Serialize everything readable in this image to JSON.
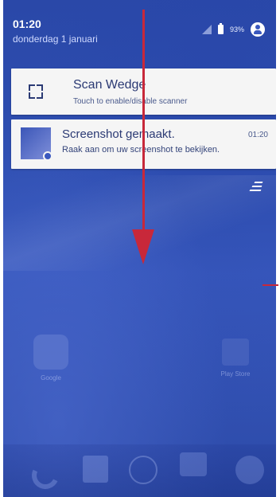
{
  "status": {
    "time": "01:20",
    "date": "donderdag 1 januari",
    "battery": "93%"
  },
  "notifications": [
    {
      "title": "Scan Wedge",
      "subtitle": "Touch to enable/disable scanner",
      "icon": "scan-icon"
    },
    {
      "title": "Screenshot gemaakt.",
      "time": "01:20",
      "subtitle": "Raak aan om uw screenshot te bekijken.",
      "icon": "screenshot-thumbnail"
    }
  ],
  "home": {
    "apps": [
      "Google",
      "Play Store"
    ],
    "dock": [
      "phone-icon",
      "contacts-icon",
      "apps-icon",
      "messages-icon",
      "browser-icon"
    ]
  },
  "colors": {
    "accent": "#c8283a",
    "shade": "#2f4fb2",
    "card": "#f5f5f5"
  }
}
